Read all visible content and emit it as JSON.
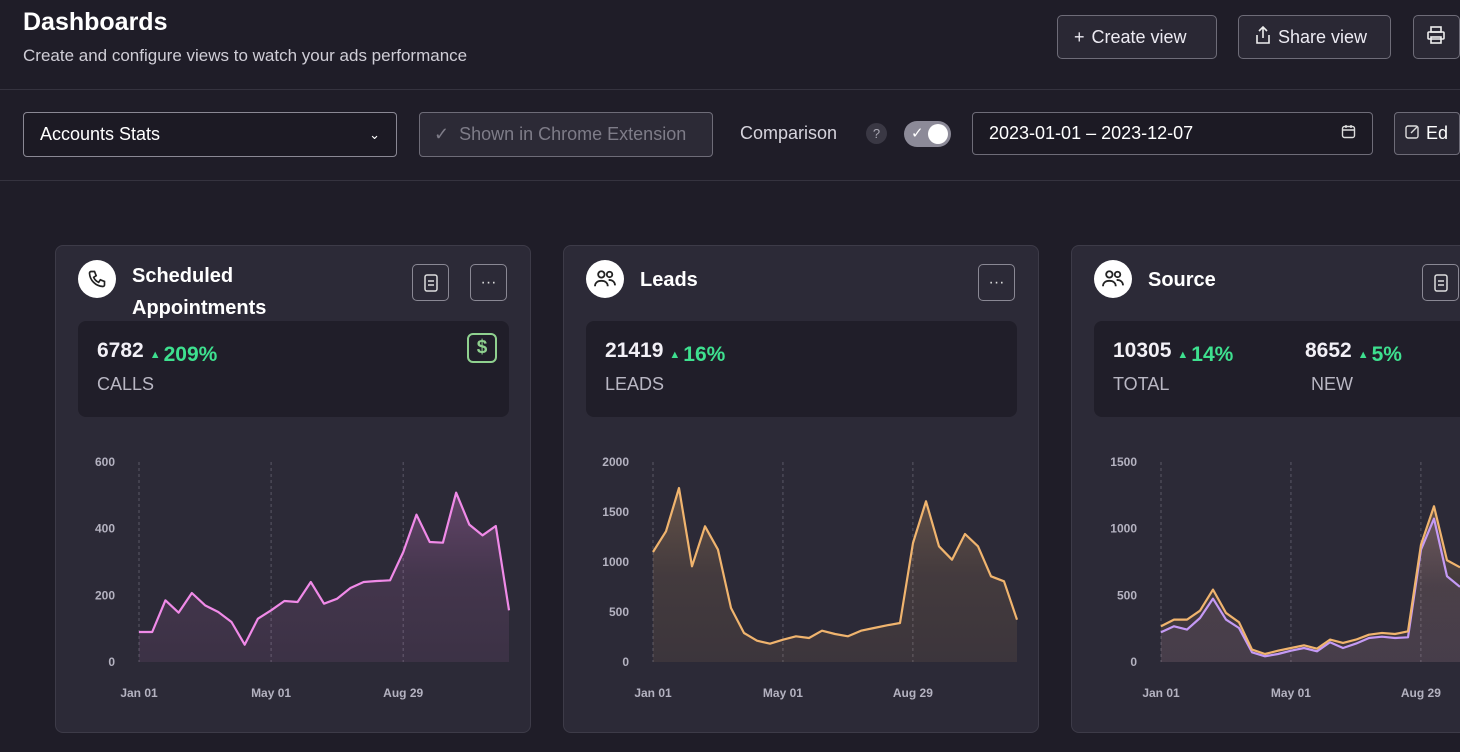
{
  "header": {
    "title": "Dashboards",
    "subtitle": "Create and configure views to watch your ads performance",
    "buttons": [
      {
        "label": "Create view",
        "icon": "plus-icon"
      },
      {
        "label": "Share view",
        "icon": "share-icon"
      },
      {
        "label": "",
        "icon": "print-icon"
      }
    ]
  },
  "filters": {
    "view_select": "Accounts Stats",
    "chrome_extension": "Shown in Chrome Extension",
    "comparison_label": "Comparison",
    "help": "?",
    "comparison_on": true,
    "date_range": "2023-01-01 – 2023-12-07",
    "edit_label": "Ed"
  },
  "colors": {
    "background": "#1f1d28",
    "card": "#2c2a37",
    "positive": "#3ee08f",
    "pink": "#f08ae8",
    "orange": "#f0b46e",
    "purple": "#c49af5"
  },
  "cards": [
    {
      "title": "Scheduled Appointments",
      "icon": "phone-icon",
      "stats": [
        {
          "value": "6782",
          "change": "209%",
          "label": "CALLS"
        }
      ]
    },
    {
      "title": "Leads",
      "icon": "users-icon",
      "stats": [
        {
          "value": "21419",
          "change": "16%",
          "label": "LEADS"
        }
      ]
    },
    {
      "title": "Source",
      "icon": "users-icon",
      "stats": [
        {
          "value": "10305",
          "change": "14%",
          "label": "TOTAL"
        },
        {
          "value": "8652",
          "change": "5%",
          "label": "NEW"
        }
      ]
    }
  ],
  "chart_data": [
    {
      "type": "area",
      "x_ticks": [
        "Jan 01",
        "May 01",
        "Aug 29"
      ],
      "ylim": [
        0,
        600
      ],
      "y_ticks": [
        "0",
        "200",
        "400",
        "600"
      ],
      "grid": "vertical-dashed",
      "series": [
        {
          "color": "#f08ae8",
          "values": [
            90,
            90,
            185,
            148,
            207,
            170,
            150,
            120,
            52,
            130,
            155,
            183,
            180,
            240,
            175,
            190,
            222,
            240,
            243,
            245,
            330,
            442,
            360,
            358,
            508,
            412,
            380,
            408,
            155
          ]
        }
      ]
    },
    {
      "type": "area",
      "x_ticks": [
        "Jan 01",
        "May 01",
        "Aug 29"
      ],
      "ylim": [
        0,
        2000
      ],
      "y_ticks": [
        "0",
        "500",
        "1000",
        "1500",
        "2000"
      ],
      "grid": "vertical-dashed",
      "series": [
        {
          "color": "#f0b46e",
          "values": [
            1100,
            1307,
            1740,
            957,
            1357,
            1123,
            540,
            290,
            213,
            183,
            223,
            257,
            240,
            313,
            280,
            257,
            313,
            340,
            367,
            390,
            1190,
            1607,
            1157,
            1023,
            1280,
            1157,
            857,
            807,
            423
          ]
        }
      ]
    },
    {
      "type": "area",
      "x_ticks": [
        "Jan 01",
        "May 01",
        "Aug 29"
      ],
      "ylim": [
        0,
        1500
      ],
      "y_ticks": [
        "0",
        "500",
        "1000",
        "1500"
      ],
      "grid": "vertical-dashed",
      "series": [
        {
          "color": "#f0b46e",
          "values": [
            268,
            318,
            318,
            385,
            543,
            368,
            298,
            93,
            60,
            85,
            105,
            125,
            100,
            168,
            143,
            168,
            205,
            218,
            210,
            230,
            880,
            1168,
            763,
            710
          ]
        },
        {
          "color": "#c49af5",
          "values": [
            223,
            268,
            243,
            330,
            475,
            318,
            255,
            73,
            43,
            60,
            85,
            105,
            80,
            148,
            105,
            138,
            180,
            190,
            180,
            185,
            843,
            1075,
            643,
            563
          ]
        }
      ]
    }
  ]
}
